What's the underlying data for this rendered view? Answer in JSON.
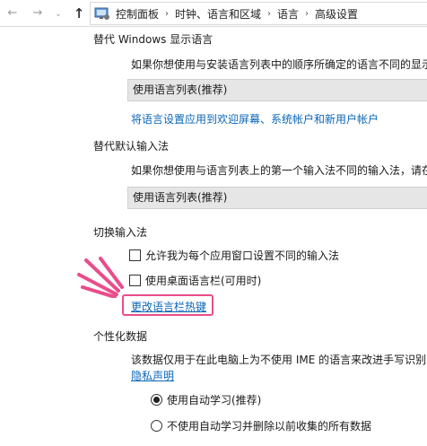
{
  "nav": {
    "back_glyph": "←",
    "forward_glyph": "→",
    "recent_glyph": "⌄",
    "up_glyph": "↑"
  },
  "breadcrumb": {
    "separator": "›",
    "items": [
      "控制面板",
      "时钟、语言和区域",
      "语言",
      "高级设置"
    ]
  },
  "display_language": {
    "title": "替代 Windows 显示语言",
    "description": "如果你想使用与安装语言列表中的顺序所确定的语言不同的显示",
    "select_value": "使用语言列表(推荐)",
    "apply_link": "将语言设置应用到欢迎屏幕、系统帐户和新用户帐户"
  },
  "input_method": {
    "title": "替代默认输入法",
    "description": "如果你想使用与语言列表上的第一个输入法不同的输入法，请在",
    "select_value": "使用语言列表(推荐)"
  },
  "switch_input": {
    "title": "切换输入法",
    "checkbox_per_app": "允许我为每个应用窗口设置不同的输入法",
    "checkbox_language_bar": "使用桌面语言栏(可用时)",
    "hotkey_link": "更改语言栏热键"
  },
  "personalization": {
    "title": "个性化数据",
    "description": "该数据仅用于在此电脑上为不使用 IME 的语言来改进手写识别",
    "privacy_link": "隐私声明",
    "radio_auto": "使用自动学习(推荐)",
    "radio_no_auto": "不使用自动学习并删除以前收集的所有数据"
  },
  "colors": {
    "link": "#0a66b7",
    "highlight": "#e94d8b"
  }
}
